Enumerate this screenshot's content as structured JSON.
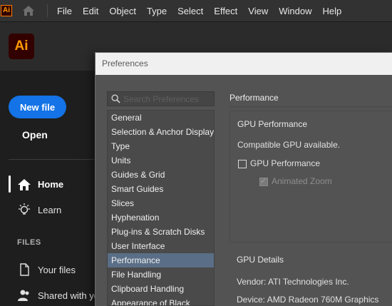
{
  "menubar": {
    "app_icon": "Ai",
    "items": [
      "File",
      "Edit",
      "Object",
      "Type",
      "Select",
      "Effect",
      "View",
      "Window",
      "Help"
    ]
  },
  "home": {
    "logo": "Ai",
    "new_file": "New file",
    "open": "Open",
    "nav": [
      {
        "label": "Home",
        "icon": "home-icon"
      },
      {
        "label": "Learn",
        "icon": "lightbulb-icon"
      }
    ],
    "files_heading": "FILES",
    "files": [
      {
        "label": "Your files",
        "icon": "file-icon"
      },
      {
        "label": "Shared with yo",
        "icon": "shared-users-icon"
      }
    ]
  },
  "preferences": {
    "title": "Preferences",
    "search_placeholder": "Search Preferences",
    "categories": [
      "General",
      "Selection & Anchor Display",
      "Type",
      "Units",
      "Guides & Grid",
      "Smart Guides",
      "Slices",
      "Hyphenation",
      "Plug-ins & Scratch Disks",
      "User Interface",
      "Performance",
      "File Handling",
      "Clipboard Handling",
      "Appearance of Black"
    ],
    "selected_category": "Performance",
    "pane_title": "Performance",
    "gpu_performance": {
      "title": "GPU Performance",
      "status": "Compatible GPU available.",
      "gpu_checkbox_label": "GPU Performance",
      "gpu_checked": false,
      "animated_zoom_label": "Animated Zoom",
      "animated_zoom_checked": true
    },
    "gpu_details": {
      "title": "GPU Details",
      "vendor": "Vendor: ATI Technologies Inc.",
      "device": "Device: AMD Radeon 760M Graphics"
    }
  },
  "colors": {
    "accent_blue": "#1473e6",
    "selected_row": "#5a6f87",
    "ai_orange": "#ff9a00",
    "ai_brown": "#330000"
  }
}
